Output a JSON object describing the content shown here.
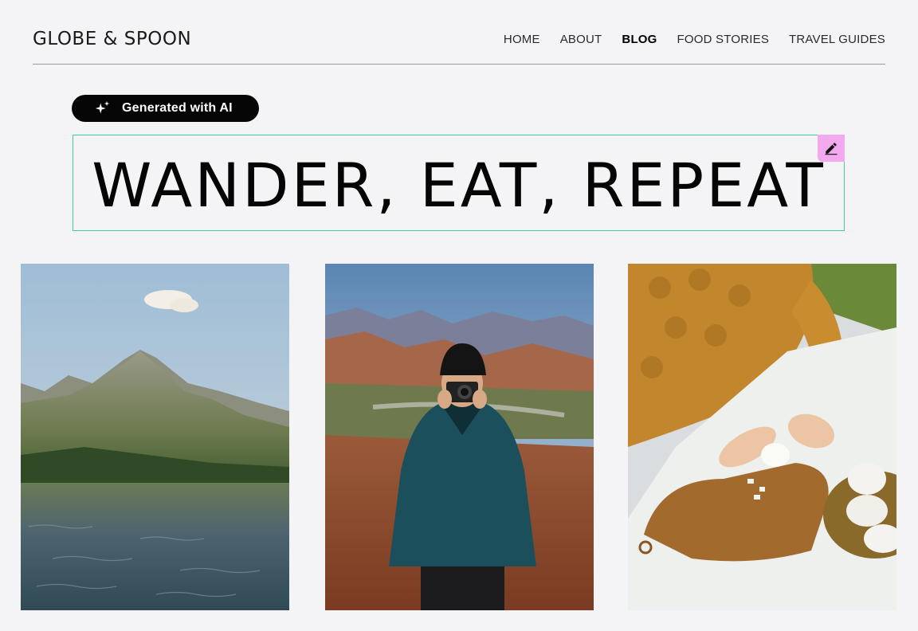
{
  "header": {
    "logo": "GLOBE & SPOON",
    "nav": [
      {
        "label": "HOME",
        "active": false
      },
      {
        "label": "ABOUT",
        "active": false
      },
      {
        "label": "BLOG",
        "active": true
      },
      {
        "label": "FOOD STORIES",
        "active": false
      },
      {
        "label": "TRAVEL GUIDES",
        "active": false
      }
    ]
  },
  "badge": {
    "label": "Generated with AI",
    "icon": "sparkle-icon"
  },
  "hero": {
    "title": "WANDER, EAT, REPEAT",
    "edit_icon": "pencil-icon"
  },
  "gallery": [
    {
      "subject": "mountain-lake-photo"
    },
    {
      "subject": "photographer-in-desert-photo"
    },
    {
      "subject": "peeling-eggs-picnic-photo"
    }
  ],
  "colors": {
    "background": "#f4f4f6",
    "badge_bg": "#050505",
    "selection_border": "#3fcf9e",
    "edit_button": "#f2a9ee"
  }
}
